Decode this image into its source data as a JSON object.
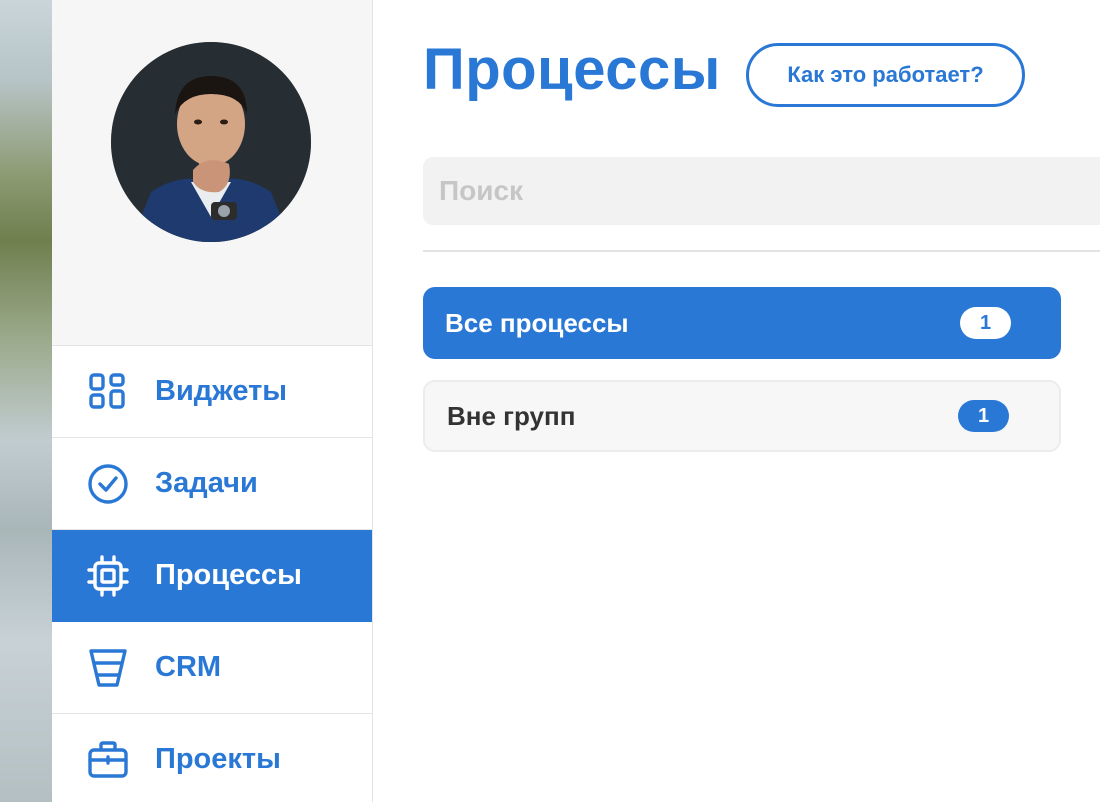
{
  "colors": {
    "accent": "#2a78d6",
    "active_text": "#ffffff",
    "muted": "#c6c6c6"
  },
  "sidebar": {
    "profile": {
      "avatar_icon": "user-photo"
    },
    "items": [
      {
        "label": "Виджеты",
        "icon": "widgets-icon"
      },
      {
        "label": "Задачи",
        "icon": "check-circle-icon"
      },
      {
        "label": "Процессы",
        "icon": "chip-icon",
        "active": true
      },
      {
        "label": "CRM",
        "icon": "funnel-icon"
      },
      {
        "label": "Проекты",
        "icon": "briefcase-icon"
      }
    ]
  },
  "main": {
    "title": "Процессы",
    "help_label": "Как это работает?",
    "search": {
      "placeholder": "Поиск",
      "value": ""
    },
    "groups": [
      {
        "label": "Все процессы",
        "count": "1",
        "selected": true
      },
      {
        "label": "Вне групп",
        "count": "1",
        "selected": false
      }
    ]
  }
}
